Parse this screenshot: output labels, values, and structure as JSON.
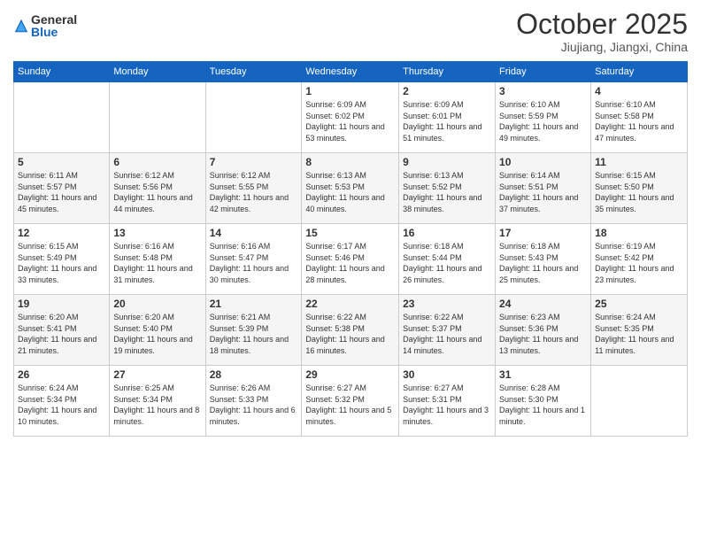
{
  "logo": {
    "general": "General",
    "blue": "Blue"
  },
  "header": {
    "month": "October 2025",
    "location": "Jiujiang, Jiangxi, China"
  },
  "weekdays": [
    "Sunday",
    "Monday",
    "Tuesday",
    "Wednesday",
    "Thursday",
    "Friday",
    "Saturday"
  ],
  "weeks": [
    [
      {
        "day": "",
        "info": ""
      },
      {
        "day": "",
        "info": ""
      },
      {
        "day": "",
        "info": ""
      },
      {
        "day": "1",
        "info": "Sunrise: 6:09 AM\nSunset: 6:02 PM\nDaylight: 11 hours\nand 53 minutes."
      },
      {
        "day": "2",
        "info": "Sunrise: 6:09 AM\nSunset: 6:01 PM\nDaylight: 11 hours\nand 51 minutes."
      },
      {
        "day": "3",
        "info": "Sunrise: 6:10 AM\nSunset: 5:59 PM\nDaylight: 11 hours\nand 49 minutes."
      },
      {
        "day": "4",
        "info": "Sunrise: 6:10 AM\nSunset: 5:58 PM\nDaylight: 11 hours\nand 47 minutes."
      }
    ],
    [
      {
        "day": "5",
        "info": "Sunrise: 6:11 AM\nSunset: 5:57 PM\nDaylight: 11 hours\nand 45 minutes."
      },
      {
        "day": "6",
        "info": "Sunrise: 6:12 AM\nSunset: 5:56 PM\nDaylight: 11 hours\nand 44 minutes."
      },
      {
        "day": "7",
        "info": "Sunrise: 6:12 AM\nSunset: 5:55 PM\nDaylight: 11 hours\nand 42 minutes."
      },
      {
        "day": "8",
        "info": "Sunrise: 6:13 AM\nSunset: 5:53 PM\nDaylight: 11 hours\nand 40 minutes."
      },
      {
        "day": "9",
        "info": "Sunrise: 6:13 AM\nSunset: 5:52 PM\nDaylight: 11 hours\nand 38 minutes."
      },
      {
        "day": "10",
        "info": "Sunrise: 6:14 AM\nSunset: 5:51 PM\nDaylight: 11 hours\nand 37 minutes."
      },
      {
        "day": "11",
        "info": "Sunrise: 6:15 AM\nSunset: 5:50 PM\nDaylight: 11 hours\nand 35 minutes."
      }
    ],
    [
      {
        "day": "12",
        "info": "Sunrise: 6:15 AM\nSunset: 5:49 PM\nDaylight: 11 hours\nand 33 minutes."
      },
      {
        "day": "13",
        "info": "Sunrise: 6:16 AM\nSunset: 5:48 PM\nDaylight: 11 hours\nand 31 minutes."
      },
      {
        "day": "14",
        "info": "Sunrise: 6:16 AM\nSunset: 5:47 PM\nDaylight: 11 hours\nand 30 minutes."
      },
      {
        "day": "15",
        "info": "Sunrise: 6:17 AM\nSunset: 5:46 PM\nDaylight: 11 hours\nand 28 minutes."
      },
      {
        "day": "16",
        "info": "Sunrise: 6:18 AM\nSunset: 5:44 PM\nDaylight: 11 hours\nand 26 minutes."
      },
      {
        "day": "17",
        "info": "Sunrise: 6:18 AM\nSunset: 5:43 PM\nDaylight: 11 hours\nand 25 minutes."
      },
      {
        "day": "18",
        "info": "Sunrise: 6:19 AM\nSunset: 5:42 PM\nDaylight: 11 hours\nand 23 minutes."
      }
    ],
    [
      {
        "day": "19",
        "info": "Sunrise: 6:20 AM\nSunset: 5:41 PM\nDaylight: 11 hours\nand 21 minutes."
      },
      {
        "day": "20",
        "info": "Sunrise: 6:20 AM\nSunset: 5:40 PM\nDaylight: 11 hours\nand 19 minutes."
      },
      {
        "day": "21",
        "info": "Sunrise: 6:21 AM\nSunset: 5:39 PM\nDaylight: 11 hours\nand 18 minutes."
      },
      {
        "day": "22",
        "info": "Sunrise: 6:22 AM\nSunset: 5:38 PM\nDaylight: 11 hours\nand 16 minutes."
      },
      {
        "day": "23",
        "info": "Sunrise: 6:22 AM\nSunset: 5:37 PM\nDaylight: 11 hours\nand 14 minutes."
      },
      {
        "day": "24",
        "info": "Sunrise: 6:23 AM\nSunset: 5:36 PM\nDaylight: 11 hours\nand 13 minutes."
      },
      {
        "day": "25",
        "info": "Sunrise: 6:24 AM\nSunset: 5:35 PM\nDaylight: 11 hours\nand 11 minutes."
      }
    ],
    [
      {
        "day": "26",
        "info": "Sunrise: 6:24 AM\nSunset: 5:34 PM\nDaylight: 11 hours\nand 10 minutes."
      },
      {
        "day": "27",
        "info": "Sunrise: 6:25 AM\nSunset: 5:34 PM\nDaylight: 11 hours\nand 8 minutes."
      },
      {
        "day": "28",
        "info": "Sunrise: 6:26 AM\nSunset: 5:33 PM\nDaylight: 11 hours\nand 6 minutes."
      },
      {
        "day": "29",
        "info": "Sunrise: 6:27 AM\nSunset: 5:32 PM\nDaylight: 11 hours\nand 5 minutes."
      },
      {
        "day": "30",
        "info": "Sunrise: 6:27 AM\nSunset: 5:31 PM\nDaylight: 11 hours\nand 3 minutes."
      },
      {
        "day": "31",
        "info": "Sunrise: 6:28 AM\nSunset: 5:30 PM\nDaylight: 11 hours\nand 1 minute."
      },
      {
        "day": "",
        "info": ""
      }
    ]
  ]
}
